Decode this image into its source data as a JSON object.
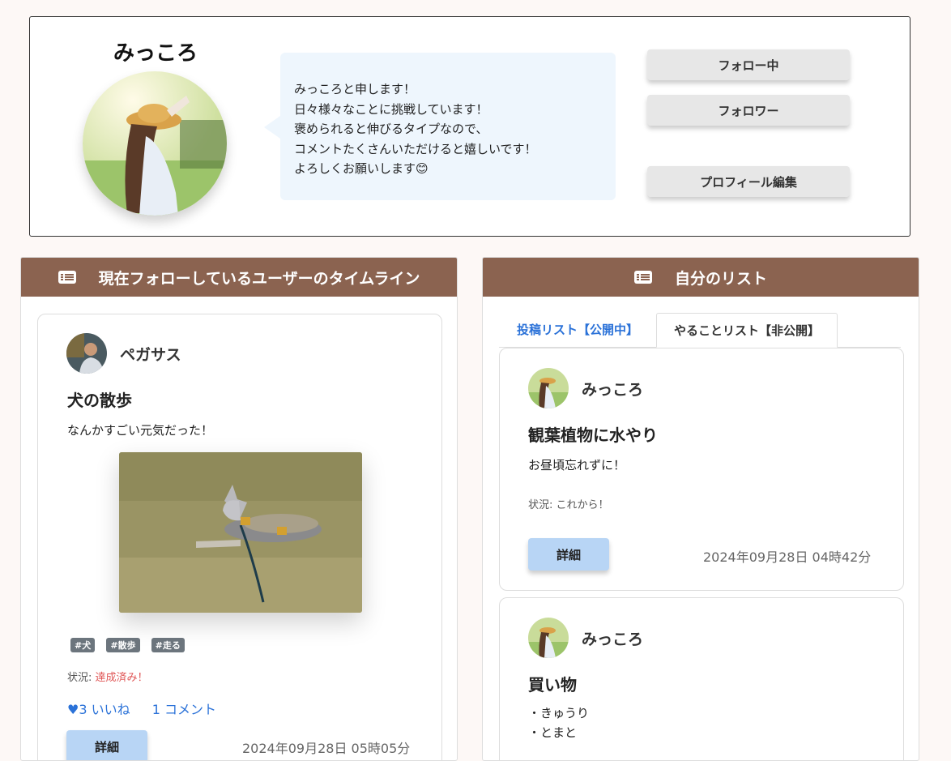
{
  "profile": {
    "name": "みっころ",
    "bio_lines": [
      "みっころと申します！",
      "日々様々なことに挑戦しています！",
      "褒められると伸びるタイプなので、",
      "コメントたくさんいただけると嬉しいです！",
      "よろしくお願いします😊"
    ],
    "buttons": {
      "following": "フォロー中",
      "followers": "フォロワー",
      "edit": "プロフィール編集"
    }
  },
  "timeline": {
    "header": "現在フォローしているユーザーのタイムライン",
    "post": {
      "user": "ペガサス",
      "title": "犬の散歩",
      "body": "なんかすごい元気だった！",
      "tags": [
        "#犬",
        "#散歩",
        "#走る"
      ],
      "status_label": "状況: ",
      "status_value": "達成済み！",
      "likes": "♥3 いいね",
      "comments": "1 コメント",
      "detail_label": "詳細",
      "date": "2024年09月28日 05時05分"
    }
  },
  "mylist": {
    "header": "自分のリスト",
    "tabs": [
      "投稿リスト【公開中】",
      "やることリスト【非公開】"
    ],
    "posts": [
      {
        "user": "みっころ",
        "title": "観葉植物に水やり",
        "body": "お昼頃忘れずに！",
        "status": "状況: これから！",
        "detail_label": "詳細",
        "date": "2024年09月28日 04時42分"
      },
      {
        "user": "みっころ",
        "title": "買い物",
        "body_lines": [
          "・きゅうり",
          "・とまと"
        ]
      }
    ]
  },
  "colors": {
    "header_bg": "#8b6350",
    "bubble_bg": "#eef6fd",
    "detail_button": "#b8d5f5",
    "link": "#2b72d8",
    "achieved": "#e05757"
  }
}
